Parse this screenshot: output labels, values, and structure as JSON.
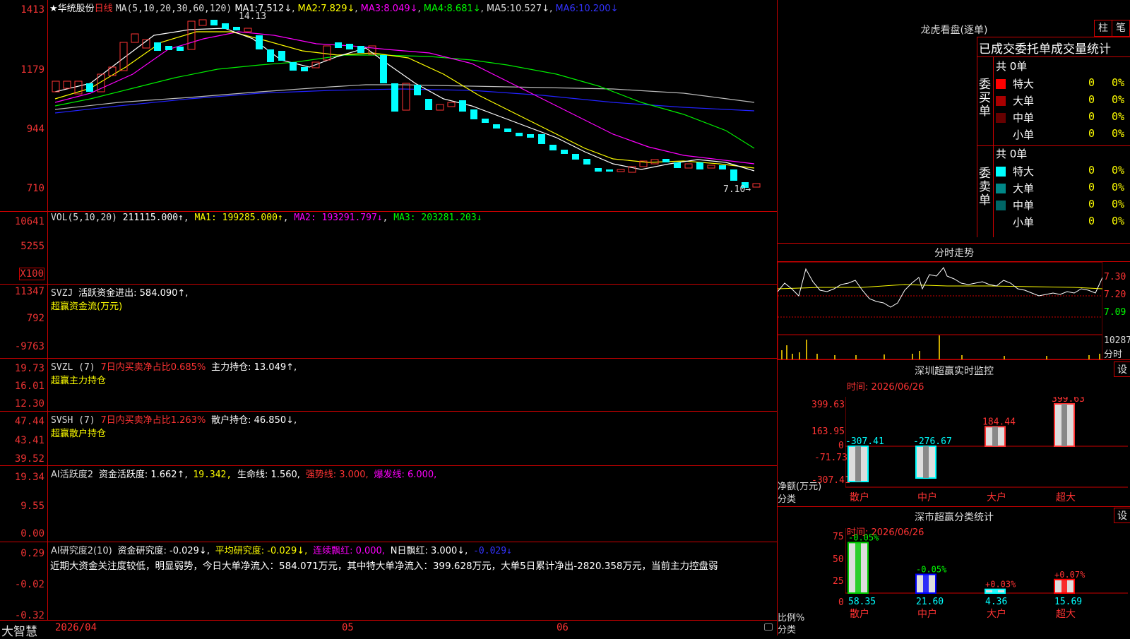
{
  "header": {
    "star": "★",
    "stock_name": "华统股份",
    "period": "日线",
    "ma_params": "MA(5,10,20,30,60,120)",
    "ma": [
      {
        "label": "MA1:",
        "value": "7.512↓",
        "color": "#ffffff"
      },
      {
        "label": "MA2:",
        "value": "7.829↓",
        "color": "#ffff00"
      },
      {
        "label": "MA3:",
        "value": "8.049↓",
        "color": "#ff00ff"
      },
      {
        "label": "MA4:",
        "value": "8.681↓",
        "color": "#00ff00"
      },
      {
        "label": "MA5:",
        "value": "10.527↓",
        "color": "#dddddd"
      },
      {
        "label": "MA6:",
        "value": "10.200↓",
        "color": "#0000ff"
      }
    ],
    "high_label": "14.13",
    "low_label": "7.10→"
  },
  "price_axis": [
    "1413",
    "1179",
    "944",
    "710"
  ],
  "vol": {
    "legend": "VOL(5,10,20)",
    "value": "211115.000↑",
    "ma1": "MA1: 199285.000↑",
    "ma2": "MA2: 193291.797↓",
    "ma3": "MA3: 203281.203↓",
    "axis": [
      "10641",
      "5255",
      "X100"
    ]
  },
  "svzj": {
    "legend": "SVZJ",
    "text": "活跃资金进出: 584.090↑,",
    "sub": "超赢资金流(万元)",
    "axis": [
      "11347",
      "792",
      "-9763"
    ]
  },
  "svzl": {
    "legend": "SVZL (7)",
    "text": "7日内买卖净占比0.685%",
    "text2": "主力持仓: 13.049↑,",
    "sub": "超赢主力持仓",
    "axis": [
      "19.73",
      "16.01",
      "12.30"
    ]
  },
  "svsh": {
    "legend": "SVSH (7)",
    "text": "7日内买卖净占比1.263%",
    "text2": "散户持仓: 46.850↓,",
    "sub": "超赢散户持仓",
    "axis": [
      "47.44",
      "43.41",
      "39.52"
    ]
  },
  "ai": {
    "legend": "AI活跃度2",
    "t1": "资金活跃度: 1.662↑,",
    "t2": "19.342,",
    "t3": "生命线: 1.560,",
    "t4": "强势线: 3.000,",
    "t5": "爆发线: 6.000,",
    "axis": [
      "19.34",
      "9.55",
      "0.00"
    ]
  },
  "ai2": {
    "legend": "AI研究度2(10)",
    "t1": "资金研究度: -0.029↓,",
    "t2": "平均研究度: -0.029↓,",
    "t3": "连续飘红: 0.000,",
    "t4": "N日飘红: 3.000↓,",
    "t5": "-0.029↓",
    "desc": "近期大资金关注度较低，明显弱势，今日大单净流入：584.071万元，其中特大单净流入：399.628万元，大单5日累计净出-2820.358万元，当前主力控盘弱",
    "axis": [
      "0.29",
      "-0.02",
      "-0.32"
    ]
  },
  "bottom": {
    "brand": "大智慧",
    "dates": [
      "2026/04",
      "05",
      "06"
    ]
  },
  "lhb": {
    "title": "龙虎看盘(逐单)",
    "btn1": "柱",
    "btn2": "笔",
    "subtitle": "已成交委托单成交量统计",
    "buy_group": "委买单",
    "sell_group": "委卖单",
    "buy_total": "共 0单",
    "sell_total": "共 0单",
    "buy_rows": [
      {
        "name": "特大",
        "n": "0",
        "p": "0%",
        "color": "#ff0000"
      },
      {
        "name": "大单",
        "n": "0",
        "p": "0%",
        "color": "#aa0000"
      },
      {
        "name": "中单",
        "n": "0",
        "p": "0%",
        "color": "#660000"
      },
      {
        "name": "小单",
        "n": "0",
        "p": "0%",
        "color": "#000000"
      }
    ],
    "sell_rows": [
      {
        "name": "特大",
        "n": "0",
        "p": "0%",
        "color": "#00ffff"
      },
      {
        "name": "大单",
        "n": "0",
        "p": "0%",
        "color": "#008888"
      },
      {
        "name": "中单",
        "n": "0",
        "p": "0%",
        "color": "#006666"
      },
      {
        "name": "小单",
        "n": "0",
        "p": "0%",
        "color": "#000000"
      }
    ]
  },
  "fenshi": {
    "title": "分时走势",
    "axis": [
      "7.30",
      "7.20",
      "7.09",
      "10287",
      "分时"
    ]
  },
  "monitor": {
    "title": "深圳超赢实时监控",
    "btn": "设",
    "time": "时间: 2026/06/26",
    "axis": [
      "399.63",
      "163.95",
      "0",
      "-71.73",
      "-307.41"
    ],
    "ylabel": "净额(万元)",
    "xlabel": "分类",
    "bars": [
      {
        "name": "散户",
        "value": -307.41,
        "label": "-307.41",
        "lc": "#00ffff"
      },
      {
        "name": "中户",
        "value": -276.67,
        "label": "-276.67",
        "lc": "#00ffff"
      },
      {
        "name": "大户",
        "value": 184.44,
        "label": "184.44",
        "lc": "#ff3333"
      },
      {
        "name": "超大",
        "value": 399.63,
        "label": "399.63",
        "lc": "#ff3333"
      }
    ]
  },
  "classify": {
    "title": "深市超赢分类统计",
    "btn": "设",
    "time": "时间: 2026/06/26",
    "axis": [
      "75",
      "50",
      "25",
      "0"
    ],
    "ylabel": "比例%",
    "xlabel": "分类",
    "bars": [
      {
        "name": "散户",
        "value": 58.35,
        "top": "-0.05%",
        "tc": "#00ff00",
        "color": "#00cc00"
      },
      {
        "name": "中户",
        "value": 21.6,
        "top": "-0.05%",
        "tc": "#00ff00",
        "color": "#0000ff"
      },
      {
        "name": "大户",
        "value": 4.36,
        "top": "+0.03%",
        "tc": "#ff3333",
        "color": "#00ffff"
      },
      {
        "name": "超大",
        "value": 15.69,
        "top": "+0.07%",
        "tc": "#ff3333",
        "color": "#ff0000"
      }
    ]
  }
}
